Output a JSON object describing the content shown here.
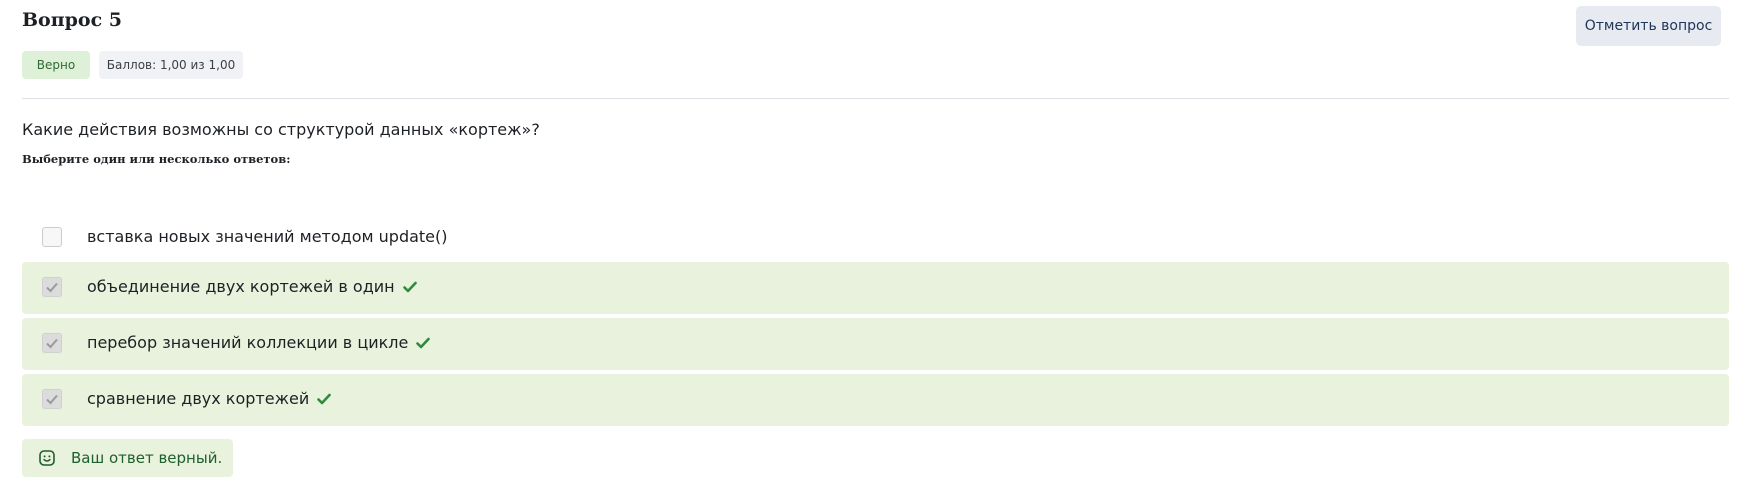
{
  "question": {
    "title": "Вопрос 5",
    "flag_label": "Отметить вопрос",
    "status_badge": "Верно",
    "score_badge": "Баллов: 1,00 из 1,00",
    "text": "Какие действия возможны со структурой данных «кортеж»?",
    "prompt": "Выберите один или несколько ответов:"
  },
  "options": [
    {
      "label": "вставка новых значений методом update()",
      "checked": false,
      "correct": false
    },
    {
      "label": "объединение двух кортежей в один",
      "checked": true,
      "correct": true
    },
    {
      "label": "перебор значений коллекции в цикле",
      "checked": true,
      "correct": true
    },
    {
      "label": "сравнение двух кортежей",
      "checked": true,
      "correct": true
    }
  ],
  "feedback": {
    "text": "Ваш ответ верный.",
    "icon": "smile-icon"
  },
  "colors": {
    "correct_bg": "#e8f2dc",
    "check_green": "#2e8b3d",
    "flag_bg": "#e7ebf1"
  }
}
